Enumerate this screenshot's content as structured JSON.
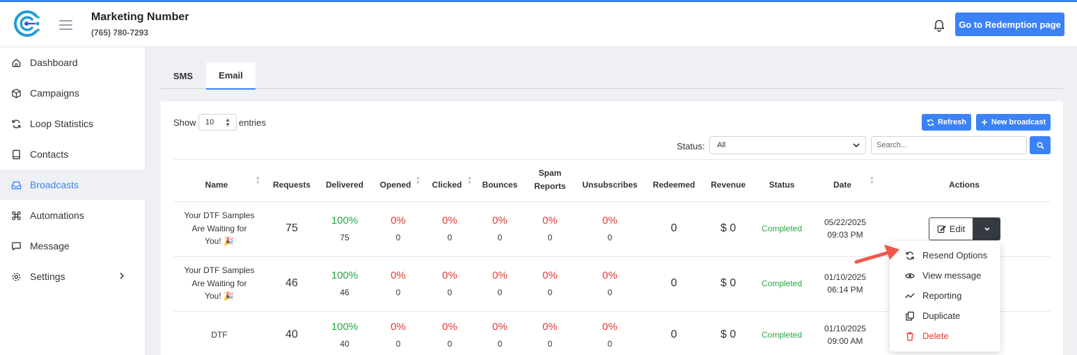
{
  "header": {
    "title": "Marketing Number",
    "phone": "(765) 780-7293",
    "redemption_button": "Go to Redemption page",
    "accent_color": "#3b82f6"
  },
  "sidebar": {
    "items": [
      {
        "label": "Dashboard",
        "icon": "home-icon"
      },
      {
        "label": "Campaigns",
        "icon": "cube-icon"
      },
      {
        "label": "Loop Statistics",
        "icon": "refresh-icon"
      },
      {
        "label": "Contacts",
        "icon": "book-icon"
      },
      {
        "label": "Broadcasts",
        "icon": "inbox-icon",
        "active": true
      },
      {
        "label": "Automations",
        "icon": "command-icon"
      },
      {
        "label": "Message",
        "icon": "chat-icon"
      },
      {
        "label": "Settings",
        "icon": "gear-icon"
      }
    ]
  },
  "tabs": {
    "sms": "SMS",
    "email": "Email",
    "active": "Email"
  },
  "toolbar": {
    "show_label": "Show",
    "entries_value": "10",
    "entries_label": "entries",
    "refresh_label": "Refresh",
    "new_broadcast_label": "New broadcast",
    "status_label": "Status:",
    "status_value": "All",
    "search_placeholder": "Search..."
  },
  "table": {
    "headers": {
      "name": "Name",
      "requests": "Requests",
      "delivered": "Delivered",
      "opened": "Opened",
      "clicked": "Clicked",
      "bounces": "Bounces",
      "spam_line1": "Spam",
      "spam_line2": "Reports",
      "unsubscribes": "Unsubscribes",
      "redeemed": "Redeemed",
      "revenue": "Revenue",
      "status": "Status",
      "date": "Date",
      "actions": "Actions"
    },
    "rows": [
      {
        "name_lines": [
          "Your DTF Samples",
          "Are Waiting for",
          "You! 🎉"
        ],
        "requests": "75",
        "delivered_pct": "100%",
        "delivered": "75",
        "opened_pct": "0%",
        "opened": "0",
        "clicked_pct": "0%",
        "clicked": "0",
        "bounces_pct": "0%",
        "bounces": "0",
        "spam_pct": "0%",
        "spam": "0",
        "unsub_pct": "0%",
        "unsub": "0",
        "redeemed": "0",
        "revenue": "$ 0",
        "status": "Completed",
        "date": "05/22/2025",
        "time": "09:03 PM"
      },
      {
        "name_lines": [
          "Your DTF Samples",
          "Are Waiting for",
          "You! 🎉"
        ],
        "requests": "46",
        "delivered_pct": "100%",
        "delivered": "46",
        "opened_pct": "0%",
        "opened": "0",
        "clicked_pct": "0%",
        "clicked": "0",
        "bounces_pct": "0%",
        "bounces": "0",
        "spam_pct": "0%",
        "spam": "0",
        "unsub_pct": "0%",
        "unsub": "0",
        "redeemed": "0",
        "revenue": "$ 0",
        "status": "Completed",
        "date": "01/10/2025",
        "time": "06:14 PM"
      },
      {
        "name_lines": [
          "DTF"
        ],
        "requests": "40",
        "delivered_pct": "100%",
        "delivered": "40",
        "opened_pct": "0%",
        "opened": "0",
        "clicked_pct": "0%",
        "clicked": "0",
        "bounces_pct": "0%",
        "bounces": "0",
        "spam_pct": "0%",
        "spam": "0",
        "unsub_pct": "0%",
        "unsub": "0",
        "redeemed": "0",
        "revenue": "$ 0",
        "status": "Completed",
        "date": "01/10/2025",
        "time": "09:00 AM"
      }
    ]
  },
  "actions": {
    "edit_label": "Edit",
    "menu": [
      {
        "label": "Resend Options",
        "icon": "resend-icon"
      },
      {
        "label": "View message",
        "icon": "eye-icon"
      },
      {
        "label": "Reporting",
        "icon": "trend-icon"
      },
      {
        "label": "Duplicate",
        "icon": "copy-icon"
      },
      {
        "label": "Delete",
        "icon": "trash-icon"
      }
    ]
  },
  "colors": {
    "success": "#28a745",
    "danger": "#e53935",
    "annotation_arrow": "#f0584a"
  }
}
